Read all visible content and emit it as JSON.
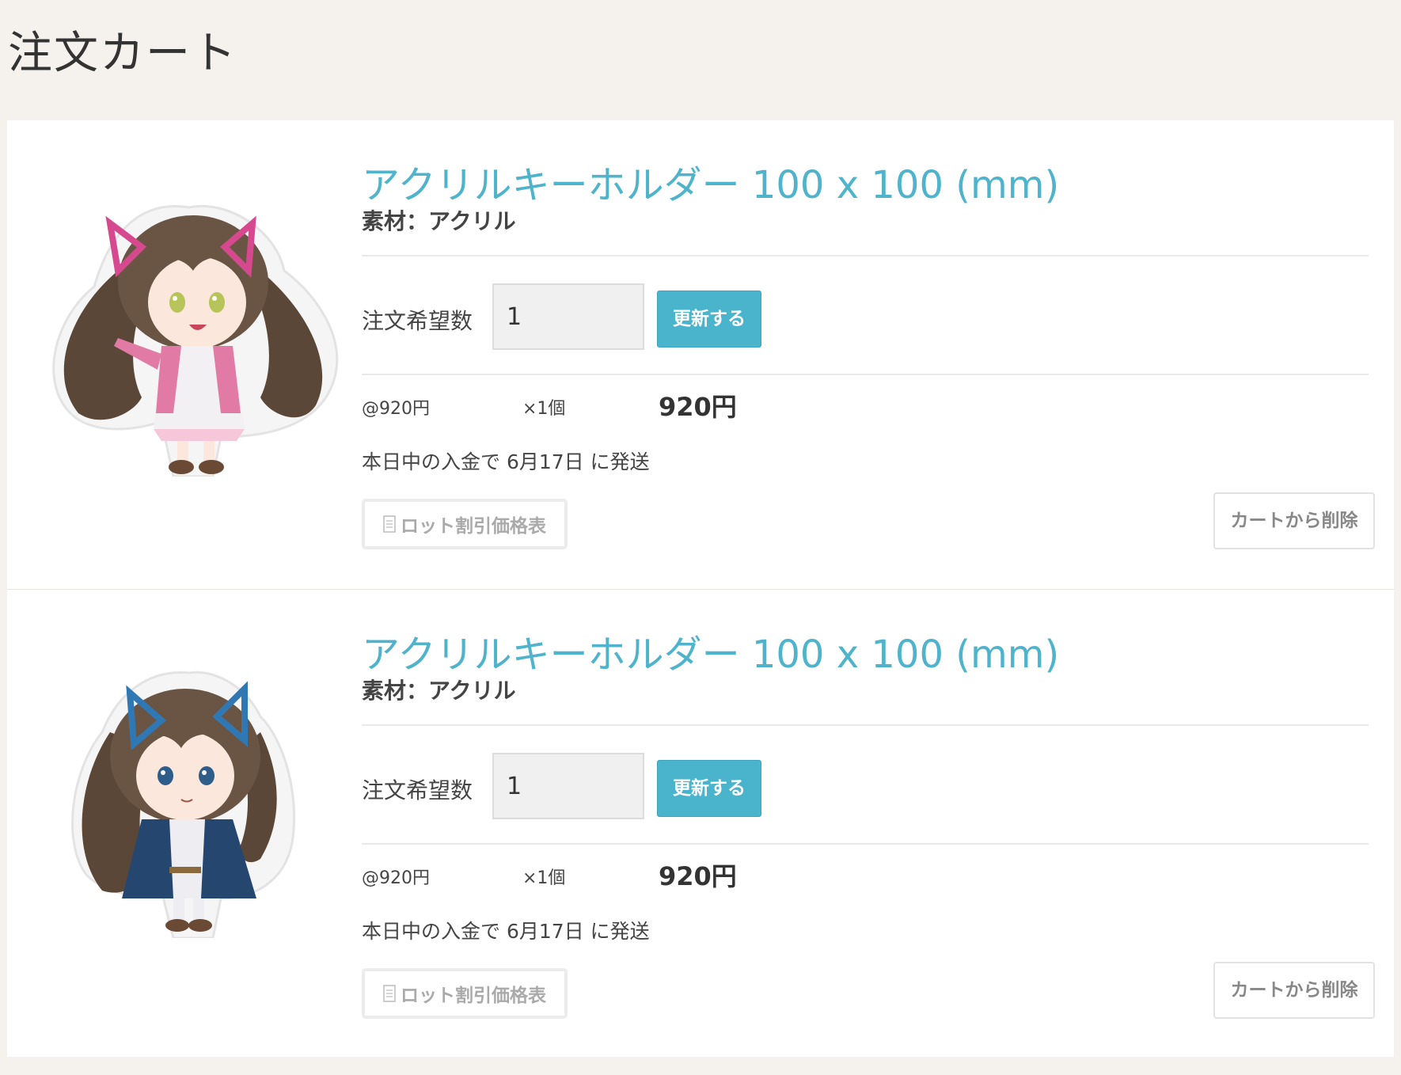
{
  "page": {
    "title": "注文カート"
  },
  "items": [
    {
      "image": "acrylic-keychain-character-pink-ribbon",
      "title": "アクリルキーホルダー 100 x 100 (mm)",
      "material": "素材：アクリル",
      "quantity_label": "注文希望数",
      "quantity_value": "1",
      "update_label": "更新する",
      "unit_price": "@920円",
      "unit_count": "×1個",
      "subtotal": "920円",
      "shipping_note": "本日中の入金で 6月17日 に発送",
      "lot_discount_label": "ロット割引価格表",
      "remove_label": "カートから削除"
    },
    {
      "image": "acrylic-keychain-character-blue-ribbon",
      "title": "アクリルキーホルダー 100 x 100 (mm)",
      "material": "素材：アクリル",
      "quantity_label": "注文希望数",
      "quantity_value": "1",
      "update_label": "更新する",
      "unit_price": "@920円",
      "unit_count": "×1個",
      "subtotal": "920円",
      "shipping_note": "本日中の入金で 6月17日 に発送",
      "lot_discount_label": "ロット割引価格表",
      "remove_label": "カートから削除"
    }
  ],
  "colors": {
    "accent": "#4ab4cc",
    "title_link": "#4fb3cc",
    "page_bg": "#f5f2ee",
    "ribbon_1": "#d6498e",
    "ribbon_2": "#2f78b4"
  }
}
